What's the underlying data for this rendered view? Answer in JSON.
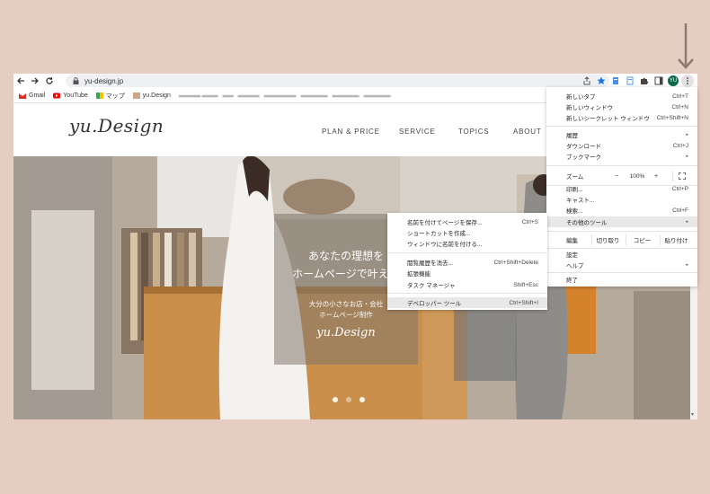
{
  "browser": {
    "url": "yu-design.jp",
    "avatar_initials": "YU",
    "accent": "#1a73e8"
  },
  "bookmarks": [
    {
      "label": "Gmail",
      "icon": "gmail-icon",
      "color": "#d93025"
    },
    {
      "label": "YouTube",
      "icon": "youtube-icon",
      "color": "#ff0000"
    },
    {
      "label": "マップ",
      "icon": "maps-icon",
      "color": "#34a853"
    },
    {
      "label": "yu.Design",
      "icon": "site-icon",
      "color": "#c9a98a"
    }
  ],
  "site": {
    "logo": "yu.Design",
    "nav": [
      "PLAN & PRICE",
      "SERVICE",
      "TOPICS",
      "ABOUT"
    ],
    "hero": {
      "line1": "あなたの理想を",
      "line2": "ホームページで叶えま",
      "sub1": "大分の小さなお店・会社",
      "sub2": "ホームページ制作",
      "logo": "yu.Design",
      "slides": 3
    }
  },
  "menu": {
    "items": [
      {
        "label": "新しいタブ",
        "shortcut": "Ctrl+T"
      },
      {
        "label": "新しいウィンドウ",
        "shortcut": "Ctrl+N"
      },
      {
        "label": "新しいシークレット ウィンドウ",
        "shortcut": "Ctrl+Shift+N"
      },
      {
        "label": "履歴",
        "shortcut": "▸"
      },
      {
        "label": "ダウンロード",
        "shortcut": "Ctrl+J"
      },
      {
        "label": "ブックマーク",
        "shortcut": "▸"
      },
      {
        "label": "印刷...",
        "shortcut": "Ctrl+P"
      },
      {
        "label": "キャスト...",
        "shortcut": ""
      },
      {
        "label": "検索...",
        "shortcut": "Ctrl+F"
      },
      {
        "label": "その他のツール",
        "shortcut": "▸"
      },
      {
        "label": "設定",
        "shortcut": ""
      },
      {
        "label": "ヘルプ",
        "shortcut": "▸"
      },
      {
        "label": "終了",
        "shortcut": ""
      }
    ],
    "zoom": {
      "label": "ズーム",
      "minus": "−",
      "value": "100%",
      "plus": "+",
      "fullscreen": "⛶"
    },
    "edit": {
      "label": "編集",
      "cut": "切り取り",
      "copy": "コピー",
      "paste": "貼り付け"
    }
  },
  "submenu": {
    "items": [
      {
        "label": "名前を付けてページを保存...",
        "shortcut": "Ctrl+S"
      },
      {
        "label": "ショートカットを作成...",
        "shortcut": ""
      },
      {
        "label": "ウィンドウに名前を付ける...",
        "shortcut": ""
      },
      {
        "label": "閲覧履歴を消去...",
        "shortcut": "Ctrl+Shift+Delete"
      },
      {
        "label": "拡張機能",
        "shortcut": ""
      },
      {
        "label": "タスク マネージャ",
        "shortcut": "Shift+Esc"
      },
      {
        "label": "デベロッパー ツール",
        "shortcut": "Ctrl+Shift+I"
      }
    ]
  }
}
